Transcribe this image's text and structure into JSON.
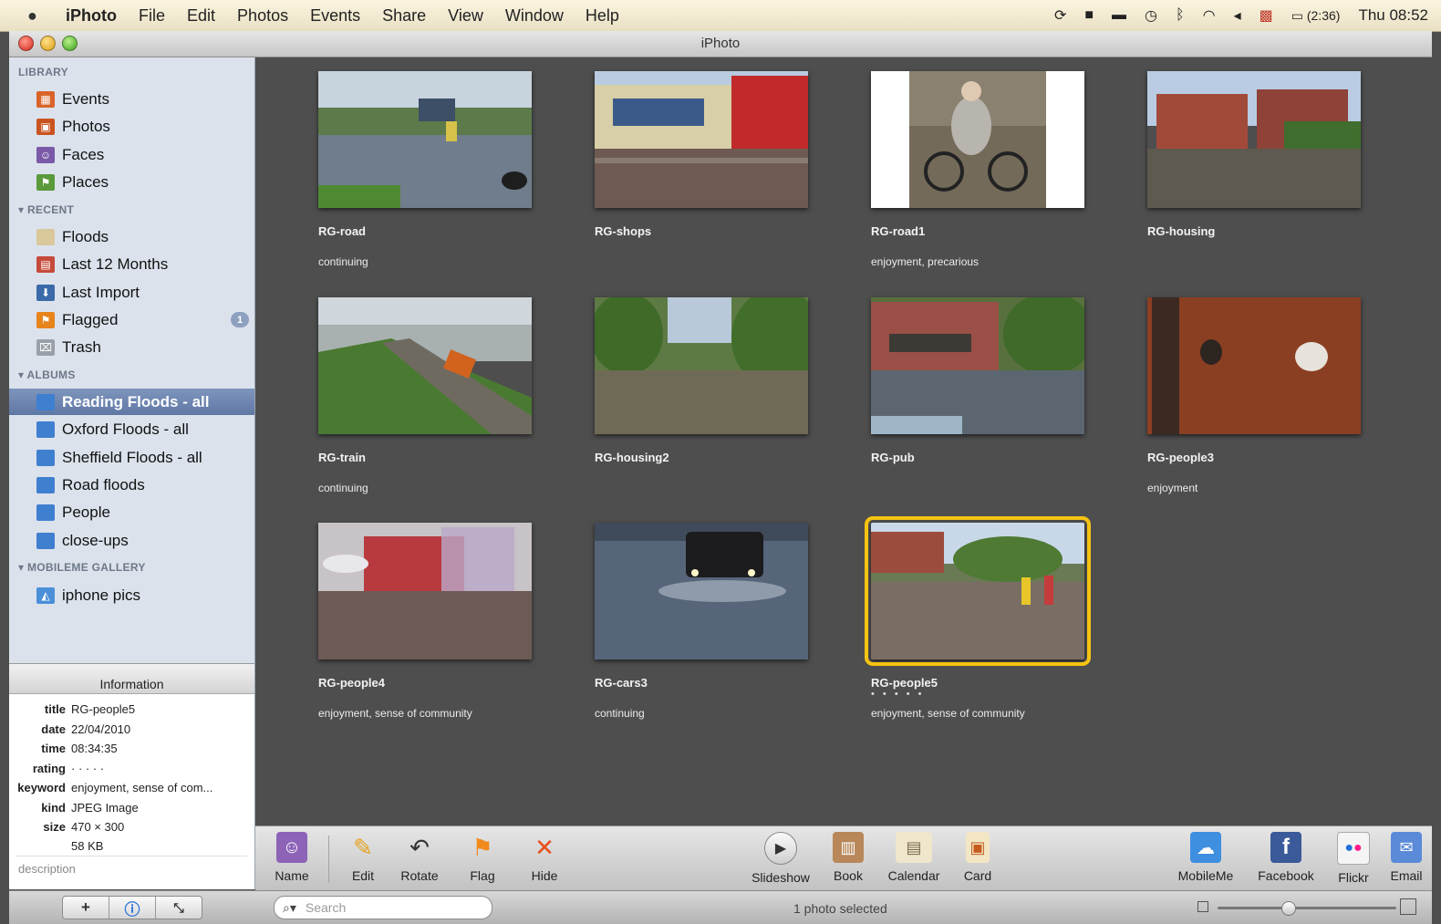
{
  "menubar": {
    "app": "iPhoto",
    "items": [
      "File",
      "Edit",
      "Photos",
      "Events",
      "Share",
      "View",
      "Window",
      "Help"
    ],
    "battery": "(2:36)",
    "clock": "Thu 08:52"
  },
  "window": {
    "title": "iPhoto"
  },
  "sidebar": {
    "library_header": "LIBRARY",
    "library": [
      {
        "label": "Events",
        "icon": "events-icon",
        "color": "#d9642a"
      },
      {
        "label": "Photos",
        "icon": "photos-icon",
        "color": "#c9541f"
      },
      {
        "label": "Faces",
        "icon": "faces-icon",
        "color": "#7a5aa8"
      },
      {
        "label": "Places",
        "icon": "places-icon",
        "color": "#5a9a3a"
      }
    ],
    "recent_header": "RECENT",
    "recent": [
      {
        "label": "Floods",
        "icon": "event-icon",
        "color": "#d9c89a"
      },
      {
        "label": "Last 12 Months",
        "icon": "calendar-icon",
        "color": "#c64a3a"
      },
      {
        "label": "Last Import",
        "icon": "import-icon",
        "color": "#3a6aa8"
      },
      {
        "label": "Flagged",
        "icon": "flag-icon",
        "color": "#e8841c",
        "badge": "1"
      },
      {
        "label": "Trash",
        "icon": "trash-icon",
        "color": "#9aa0a8"
      }
    ],
    "albums_header": "ALBUMS",
    "albums": [
      {
        "label": "Reading Floods - all",
        "selected": true
      },
      {
        "label": "Oxford Floods - all"
      },
      {
        "label": "Sheffield Floods - all"
      },
      {
        "label": "Road floods"
      },
      {
        "label": "People"
      },
      {
        "label": "close-ups"
      }
    ],
    "mobileme_header": "MOBILEME GALLERY",
    "mobileme": [
      {
        "label": "iphone pics"
      }
    ]
  },
  "info": {
    "header": "Information",
    "rows": [
      {
        "k": "title",
        "v": "RG-people5"
      },
      {
        "k": "date",
        "v": "22/04/2010"
      },
      {
        "k": "time",
        "v": "08:34:35"
      },
      {
        "k": "rating",
        "v": "· · · · ·"
      },
      {
        "k": "keyword",
        "v": "enjoyment, sense of com..."
      },
      {
        "k": "kind",
        "v": "JPEG Image"
      },
      {
        "k": "size",
        "v": "470 × 300"
      },
      {
        "k": "",
        "v": "58 KB"
      }
    ],
    "description_placeholder": "description"
  },
  "photos": [
    {
      "title": "RG-road",
      "keywords": "continuing",
      "stars": ""
    },
    {
      "title": "RG-shops",
      "keywords": "",
      "stars": ""
    },
    {
      "title": "RG-road1",
      "keywords": "enjoyment, precarious",
      "stars": ""
    },
    {
      "title": "RG-housing",
      "keywords": "",
      "stars": ""
    },
    {
      "title": "RG-train",
      "keywords": "continuing",
      "stars": ""
    },
    {
      "title": "RG-housing2",
      "keywords": "",
      "stars": ""
    },
    {
      "title": "RG-pub",
      "keywords": "",
      "stars": ""
    },
    {
      "title": "RG-people3",
      "keywords": "enjoyment",
      "stars": ""
    },
    {
      "title": "RG-people4",
      "keywords": "enjoyment, sense of community",
      "stars": ""
    },
    {
      "title": "RG-cars3",
      "keywords": "continuing",
      "stars": ""
    },
    {
      "title": "RG-people5",
      "keywords": "enjoyment, sense of community",
      "stars": "• • • • •",
      "selected": true
    }
  ],
  "toolbar": {
    "name": "Name",
    "edit": "Edit",
    "rotate": "Rotate",
    "flag": "Flag",
    "hide": "Hide",
    "slideshow": "Slideshow",
    "book": "Book",
    "calendar": "Calendar",
    "card": "Card",
    "mobileme": "MobileMe",
    "facebook": "Facebook",
    "flickr": "Flickr",
    "email": "Email"
  },
  "bottombar": {
    "search_placeholder": "Search",
    "status": "1 photo selected"
  },
  "colors": {
    "selection_outline": "#f5c412",
    "grid_bg": "#4e4e4e",
    "sidebar_bg": "#dbe2ec"
  }
}
